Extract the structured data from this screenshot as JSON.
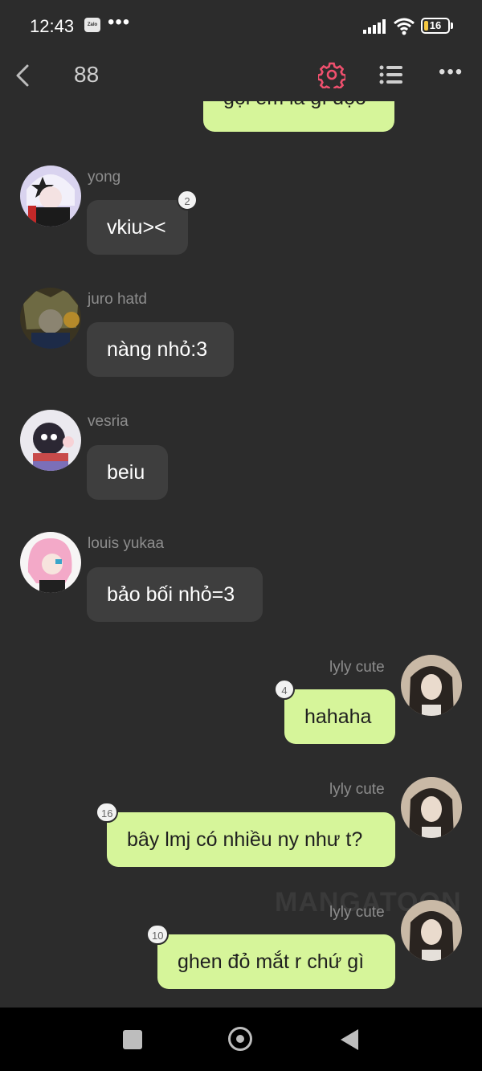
{
  "status_bar": {
    "time": "12:43",
    "notification_app": "Zalo",
    "more": "•••",
    "battery": "16",
    "battery_level": 0.16
  },
  "top_bar": {
    "title": "88",
    "icons": [
      "back-icon",
      "gear-icon",
      "list-icon",
      "more-icon"
    ],
    "more": "•••",
    "accent_color": "#f0506e"
  },
  "chat": {
    "partial_top_message": "gọi em là gì đọo",
    "messages": [
      {
        "sender": "yong",
        "text": "vkiu><",
        "badge": "2",
        "side": "left"
      },
      {
        "sender": "juro hatd",
        "text": "nàng nhỏ:3",
        "badge": "",
        "side": "left"
      },
      {
        "sender": "vesria",
        "text": "beiu",
        "badge": "",
        "side": "left"
      },
      {
        "sender": "louis yukaa",
        "text": "bảo bối nhỏ=3",
        "badge": "",
        "side": "left"
      },
      {
        "sender": "lyly cute",
        "text": "hahaha",
        "badge": "4",
        "side": "right"
      },
      {
        "sender": "lyly cute",
        "text": "bây lmj có nhiều ny như t?",
        "badge": "16",
        "side": "right"
      },
      {
        "sender": "lyly cute",
        "text": "ghen đỏ mắt r chứ gì",
        "badge": "10",
        "side": "right"
      }
    ],
    "watermark": "MANGATOON"
  },
  "colors": {
    "background": "#2c2c2c",
    "left_bubble": "#3e3e3e",
    "right_bubble": "#d6f59a",
    "name_text": "#8d8d8d"
  }
}
